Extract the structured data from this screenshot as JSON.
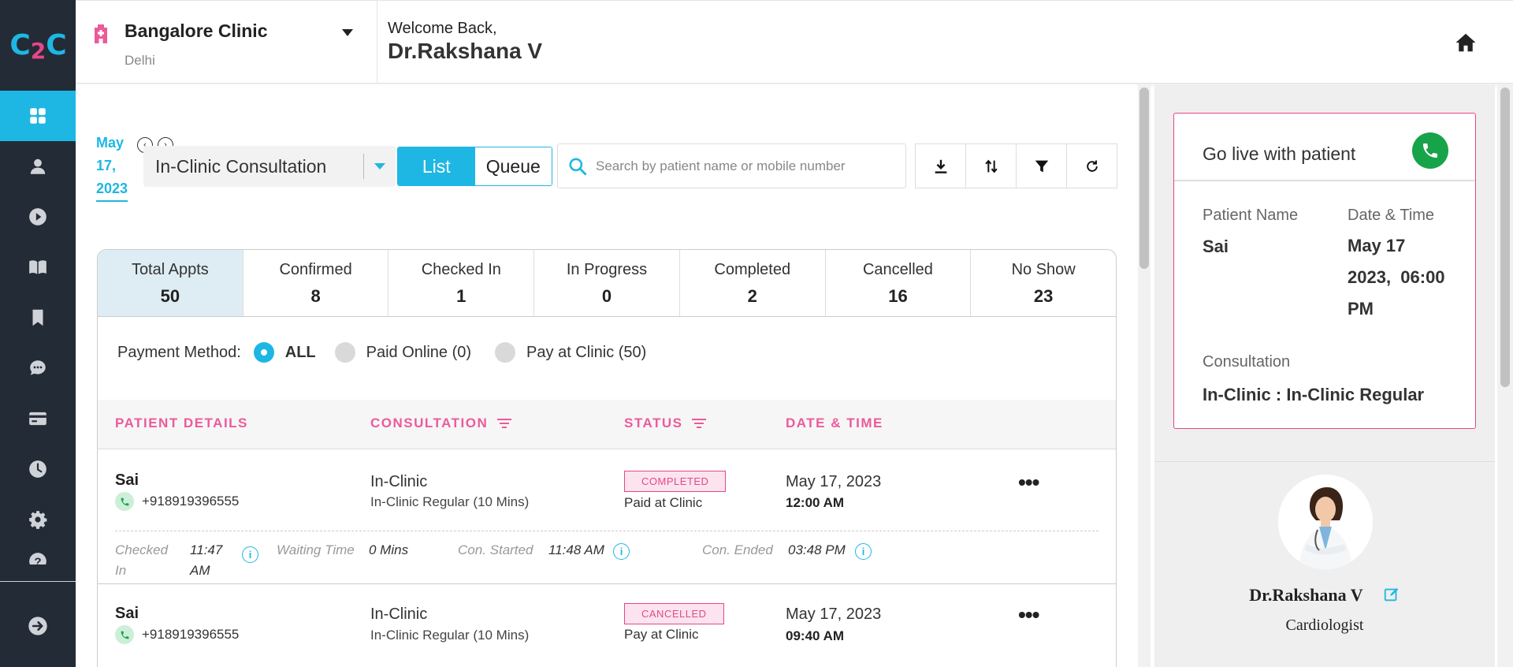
{
  "app": {
    "logo_c1": "C",
    "logo_2": "2",
    "logo_c2": "C"
  },
  "sidebar": {
    "items": [
      {
        "icon": "dashboard-icon",
        "active": true
      },
      {
        "icon": "user-icon"
      },
      {
        "icon": "play-icon"
      },
      {
        "icon": "book-icon"
      },
      {
        "icon": "bookmark-icon"
      },
      {
        "icon": "chat-icon"
      },
      {
        "icon": "card-icon"
      },
      {
        "icon": "clock-icon"
      },
      {
        "icon": "settings-icon"
      },
      {
        "icon": "help-icon"
      }
    ],
    "bottom_icon": "logout-icon"
  },
  "header": {
    "clinic_name": "Bangalore Clinic",
    "clinic_city": "Delhi",
    "welcome": "Welcome Back,",
    "doctor": "Dr.Rakshana V"
  },
  "toolbar": {
    "date_line1": "May",
    "date_line2": "17,",
    "date_line3": "2023",
    "consultation_type": "In-Clinic Consultation",
    "view_list": "List",
    "view_queue": "Queue",
    "search_placeholder": "Search by patient name or mobile number"
  },
  "stats": [
    {
      "label": "Total Appts",
      "value": "50"
    },
    {
      "label": "Confirmed",
      "value": "8"
    },
    {
      "label": "Checked In",
      "value": "1"
    },
    {
      "label": "In Progress",
      "value": "0"
    },
    {
      "label": "Completed",
      "value": "2"
    },
    {
      "label": "Cancelled",
      "value": "16"
    },
    {
      "label": "No Show",
      "value": "23"
    }
  ],
  "payment": {
    "label": "Payment Method:",
    "all": "ALL",
    "online": "Paid Online (0)",
    "clinic": "Pay at Clinic (50)"
  },
  "table": {
    "headers": {
      "patient": "PATIENT DETAILS",
      "consultation": "CONSULTATION",
      "status": "STATUS",
      "datetime": "DATE & TIME"
    },
    "rows": [
      {
        "name": "Sai",
        "phone": "+918919396555",
        "type": "In-Clinic",
        "sub": "In-Clinic Regular (10 Mins)",
        "badge": "COMPLETED",
        "payment": "Paid at Clinic",
        "date": "May 17, 2023",
        "time": "12:00 AM",
        "checked_label_1": "Checked",
        "checked_label_2": "In",
        "checked_value_1": "11:47",
        "checked_value_2": "AM",
        "waiting_label": "Waiting Time",
        "waiting_value": "0 Mins",
        "started_label": "Con. Started",
        "started_value": "11:48 AM",
        "ended_label": "Con. Ended",
        "ended_value": "03:48 PM"
      },
      {
        "name": "Sai",
        "phone": "+918919396555",
        "type": "In-Clinic",
        "sub": "In-Clinic Regular (10 Mins)",
        "badge": "CANCELLED",
        "payment": "Pay at Clinic",
        "date": "May 17, 2023",
        "time": "09:40 AM"
      }
    ]
  },
  "live": {
    "title": "Go live with patient",
    "patient_label": "Patient Name",
    "patient_value": "Sai",
    "datetime_label": "Date & Time",
    "datetime_l1": "May 17",
    "datetime_l2": "2023,  06:00",
    "datetime_l3": "PM",
    "consult_label": "Consultation",
    "consult_value": "In-Clinic : In-Clinic Regular"
  },
  "doctor_card": {
    "name": "Dr.Rakshana V",
    "specialty": "Cardiologist"
  },
  "colors": {
    "accent": "#1eb7e3",
    "pink": "#e5478b",
    "sidebar": "#232b36",
    "green": "#17a34a"
  }
}
